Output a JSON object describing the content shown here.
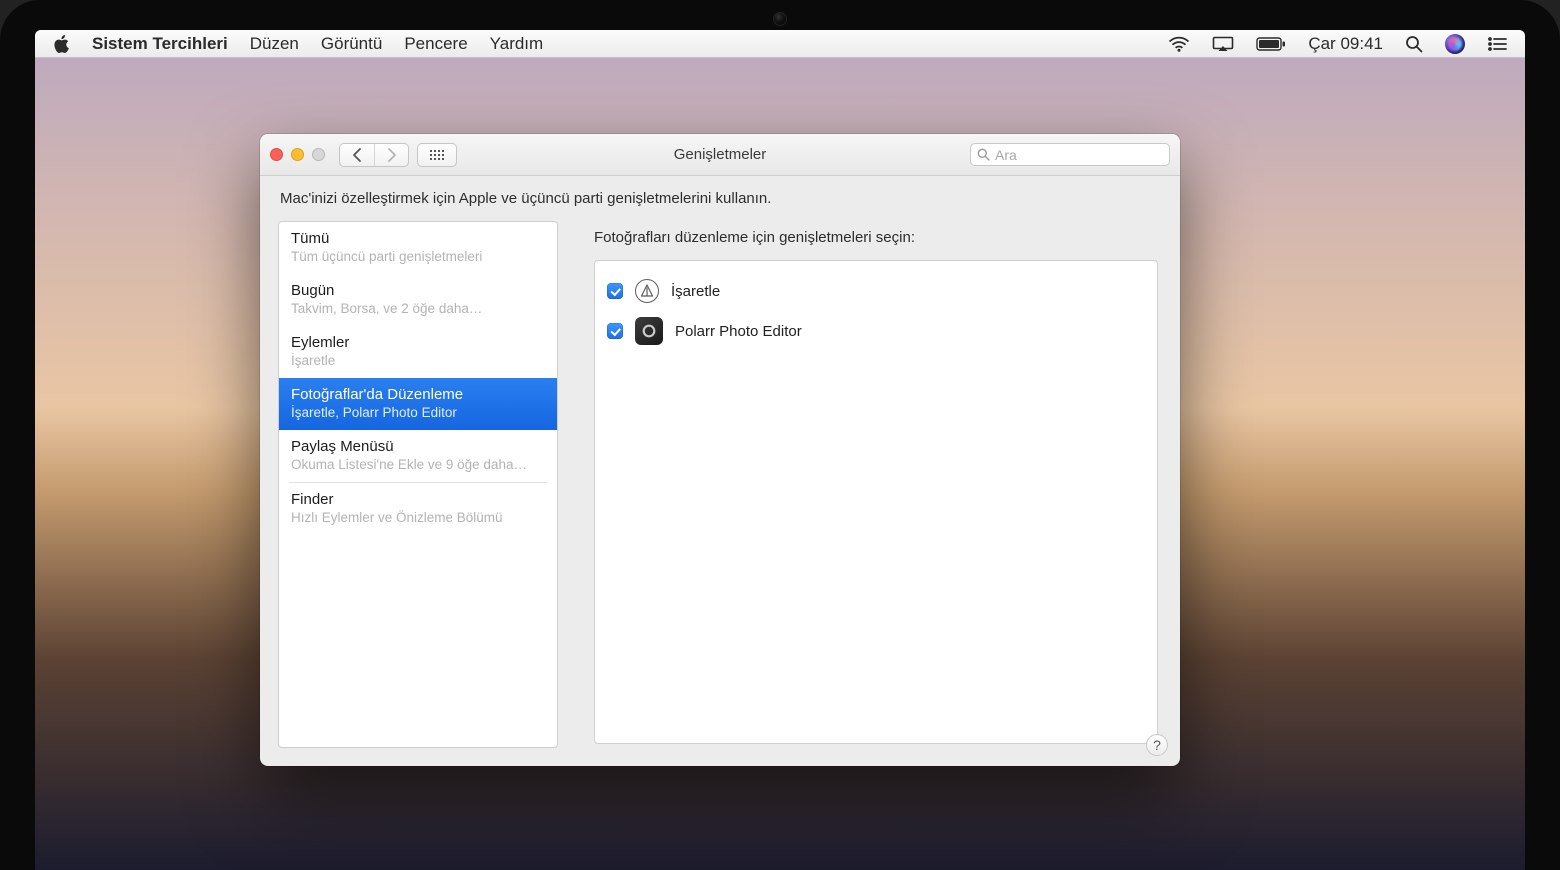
{
  "menubar": {
    "app_name": "Sistem Tercihleri",
    "items": [
      "Düzen",
      "Görüntü",
      "Pencere",
      "Yardım"
    ],
    "clock": "Çar 09:41"
  },
  "window": {
    "title": "Genişletmeler",
    "search_placeholder": "Ara",
    "intro": "Mac'inizi özelleştirmek için Apple ve üçüncü parti genişletmelerini kullanın."
  },
  "sidebar": {
    "items": [
      {
        "title": "Tümü",
        "subtitle": "Tüm üçüncü parti genişletmeleri",
        "selected": false
      },
      {
        "title": "Bugün",
        "subtitle": "Takvim, Borsa, ve 2 öğe daha…",
        "selected": false
      },
      {
        "title": "Eylemler",
        "subtitle": "İşaretle",
        "selected": false
      },
      {
        "title": "Fotoğraflar'da Düzenleme",
        "subtitle": "İşaretle, Polarr Photo Editor",
        "selected": true
      },
      {
        "title": "Paylaş Menüsü",
        "subtitle": "Okuma Listesi'ne Ekle ve 9 öğe daha…",
        "selected": false
      },
      {
        "title": "Finder",
        "subtitle": "Hızlı Eylemler ve Önizleme Bölümü",
        "selected": false,
        "separated": true
      }
    ]
  },
  "detail": {
    "heading": "Fotoğrafları düzenleme için genişletmeleri seçin:",
    "extensions": [
      {
        "label": "İşaretle",
        "checked": true,
        "icon": "markup"
      },
      {
        "label": "Polarr Photo Editor",
        "checked": true,
        "icon": "polarr"
      }
    ]
  },
  "help_label": "?"
}
